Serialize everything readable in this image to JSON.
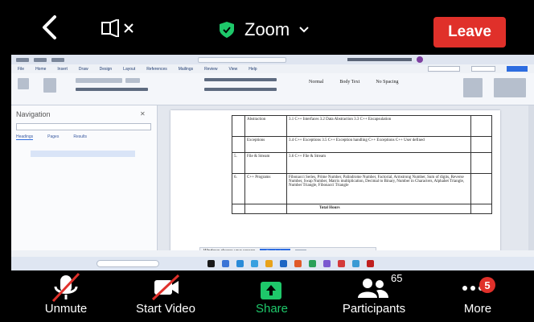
{
  "top_bar": {
    "app_title": "Zoom",
    "leave_label": "Leave"
  },
  "shared_screen": {
    "ribbon_styles": [
      "Normal",
      "Body Text",
      "No Spacing"
    ],
    "navigation_title": "Navigation",
    "nav_tabs": [
      "Headings",
      "Pages",
      "Results"
    ],
    "table_rows": [
      {
        "num": "",
        "topic": "Abstraction",
        "detail": "3.1 C++ Interfaces 3.2 Data Abstraction 3.3 C++ Encapsulation"
      },
      {
        "num": "",
        "topic": "Exceptions",
        "detail": "3.4 C++ Exceptions 3.5 C++ Exception handling C++ Exceptions C++ User defined"
      },
      {
        "num": "5.",
        "topic": "File & Stream",
        "detail": "3.6 C++ File & Stream"
      },
      {
        "num": "6.",
        "topic": "C++ Programs",
        "detail": "Fibonacci Series, Prime Number, Palindrome Number, Factorial, Armstrong Number, Sum of digits, Reverse Number, Swap Number, Matrix multiplication, Decimal to Binary, Number in Characters, Alphabet Triangle, Number Triangle, Fibonacci Triangle"
      },
      {
        "num": "",
        "topic": "",
        "detail": "Total Hours"
      }
    ],
    "share_hint": "Windows shares your screen",
    "share_button": "Stop sharing",
    "share_hide": "Hide"
  },
  "bottom_bar": {
    "unmute_label": "Unmute",
    "video_label": "Start Video",
    "share_label": "Share",
    "participants_label": "Participants",
    "participants_count": "65",
    "more_label": "More",
    "more_badge": "5"
  },
  "colors": {
    "leave_red": "#e0302a",
    "share_green": "#1ec86a",
    "shield_green": "#1ec86a"
  }
}
